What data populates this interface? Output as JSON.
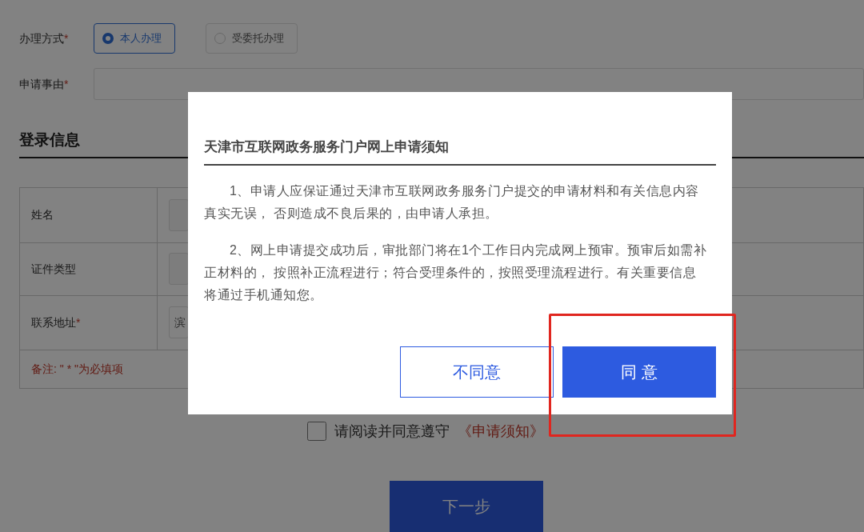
{
  "form": {
    "mode": {
      "label": "办理方式",
      "mark": "*",
      "options": [
        {
          "label": "本人办理",
          "selected": true
        },
        {
          "label": "受委托办理",
          "selected": false
        }
      ]
    },
    "reason": {
      "label": "申请事由",
      "mark": "*"
    },
    "section_title": "登录信息",
    "rows": [
      {
        "label": "姓名"
      },
      {
        "label": "证件类型"
      },
      {
        "label": "联系地址",
        "mark": "*",
        "value": "滨"
      }
    ],
    "note": "备注: \" * \"为必填项",
    "agreement": {
      "checked": false,
      "text": "请阅读并同意遵守",
      "link": "《申请须知》"
    },
    "next_button": "下一步"
  },
  "dialog": {
    "title": "天津市互联网政务服务门户网上申请须知",
    "paragraphs": [
      "1、申请人应保证通过天津市互联网政务服务门户提交的申请材料和有关信息内容真实无误， 否则造成不良后果的，由申请人承担。",
      "2、网上申请提交成功后，审批部门将在1个工作日内完成网上预审。预审后如需补正材料的， 按照补正流程进行；符合受理条件的，按照受理流程进行。有关重要信息将通过手机通知您。"
    ],
    "buttons": [
      {
        "label": "不同意",
        "kind": "secondary"
      },
      {
        "label": "同 意",
        "kind": "primary"
      }
    ]
  }
}
